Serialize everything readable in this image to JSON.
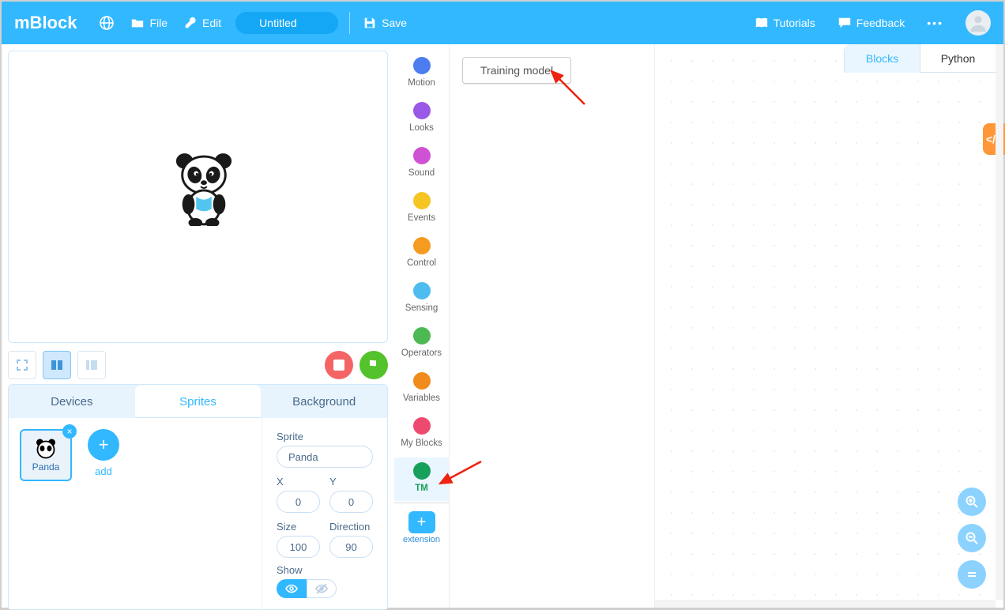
{
  "app": {
    "logo": "mBlock"
  },
  "topbar": {
    "file": "File",
    "edit": "Edit",
    "project_name": "Untitled",
    "save": "Save",
    "tutorials": "Tutorials",
    "feedback": "Feedback"
  },
  "stage_controls": {
    "stop": "stop",
    "flag": "flag"
  },
  "asset_tabs": {
    "devices": "Devices",
    "sprites": "Sprites",
    "background": "Background",
    "active": "sprites"
  },
  "sprite": {
    "thumb_name": "Panda",
    "add_label": "add",
    "label_sprite": "Sprite",
    "name": "Panda",
    "label_x": "X",
    "x": "0",
    "label_y": "Y",
    "y": "0",
    "label_size": "Size",
    "size": "100",
    "label_direction": "Direction",
    "direction": "90",
    "label_show": "Show"
  },
  "categories": [
    {
      "label": "Motion",
      "color": "#4c7cf0"
    },
    {
      "label": "Looks",
      "color": "#9a58e6"
    },
    {
      "label": "Sound",
      "color": "#cf52d4"
    },
    {
      "label": "Events",
      "color": "#f6c523"
    },
    {
      "label": "Control",
      "color": "#f59b20"
    },
    {
      "label": "Sensing",
      "color": "#4fbcf0"
    },
    {
      "label": "Operators",
      "color": "#4cb953"
    },
    {
      "label": "Variables",
      "color": "#f08b1e"
    },
    {
      "label": "My Blocks",
      "color": "#ee4a6f"
    },
    {
      "label": "TM",
      "color": "#16a05c",
      "active": true
    }
  ],
  "extension": {
    "label": "extension"
  },
  "palette": {
    "training_model": "Training model"
  },
  "view_tabs": {
    "blocks": "Blocks",
    "python": "Python",
    "active": "blocks"
  }
}
